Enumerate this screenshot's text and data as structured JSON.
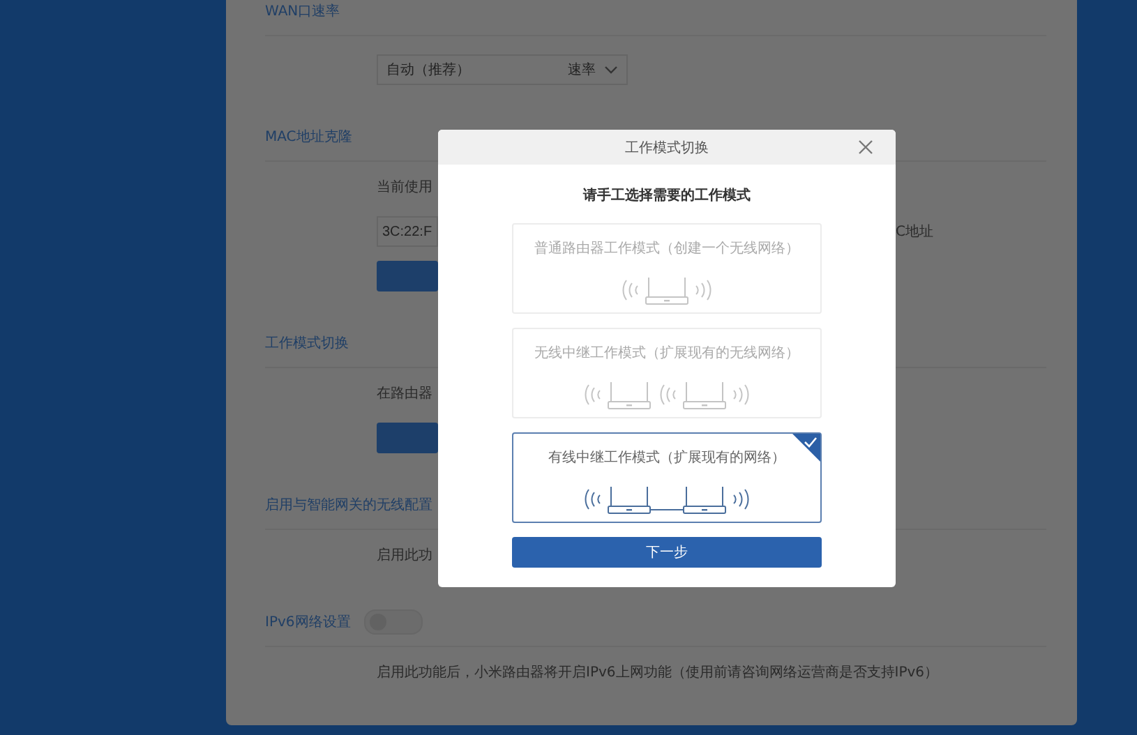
{
  "settings": {
    "wan_speed": {
      "title": "WAN口速率",
      "select_value": "自动（推荐）",
      "select_unit": "速率"
    },
    "mac_clone": {
      "title": "MAC地址克隆",
      "description": "当前使用",
      "field_value": "3C:22:F",
      "side_text": "C地址"
    },
    "work_mode": {
      "title": "工作模式切换",
      "description": "在路由器"
    },
    "smart_gateway": {
      "title": "启用与智能网关的无线配置",
      "description": "启用此功"
    },
    "ipv6": {
      "title": "IPv6网络设置",
      "on": false,
      "description": "启用此功能后，小米路由器将开启IPv6上网功能（使用前请咨询网络运营商是否支持IPv6）"
    }
  },
  "dialog": {
    "title": "工作模式切换",
    "prompt": "请手工选择需要的工作模式",
    "modes": [
      {
        "label": "普通路由器工作模式（创建一个无线网络）",
        "kind": "router",
        "selected": false
      },
      {
        "label": "无线中继工作模式（扩展现有的无线网络）",
        "kind": "wireless_repeater",
        "selected": false
      },
      {
        "label": "有线中继工作模式（扩展现有的网络）",
        "kind": "wired_repeater",
        "selected": true
      }
    ],
    "next_button": "下一步"
  }
}
